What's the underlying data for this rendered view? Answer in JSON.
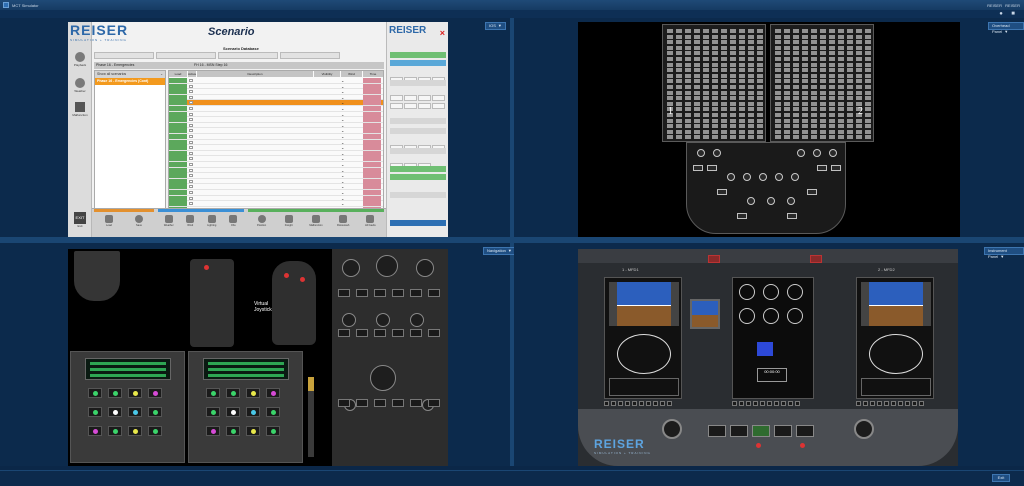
{
  "window": {
    "title": "MCT Simulator",
    "user": "REISER",
    "role": "REISER"
  },
  "quadrants": {
    "q1": {
      "view": "IOS"
    },
    "q2": {
      "view": "Overhead Panel"
    },
    "q3": {
      "view": "Navigation"
    },
    "q4": {
      "view": "Instrument Panel"
    }
  },
  "scenario": {
    "brand": "REISER",
    "tagline": "SIMULATION + TRAINING",
    "title": "Scenario",
    "database_title": "Scenario Database",
    "phase_label": "Phase 16 - Emergencies",
    "phase_right": "FH 16 - MSN Step 16",
    "list_header": "Show all scenarios",
    "selected_scenario": "Phase 16 - Emergencies (Cont)",
    "columns": [
      "Load",
      "Active",
      "Description",
      "Visibility",
      "Wind",
      "Time"
    ],
    "right_brand": "REISER",
    "right_close": "×",
    "exit_label": "EXIT",
    "exit_text": "Exit",
    "side_buttons": [
      "Playback",
      "Weather",
      "Malfunction"
    ],
    "bottom_groups": [
      {
        "label": "Scenario",
        "items": [
          "Load",
          "Save"
        ]
      },
      {
        "label": "Freeze",
        "items": [
          "Weather",
          "Wind",
          "Lighting",
          "Obs"
        ]
      },
      {
        "label": "Position",
        "items": [
          "Position",
          "Freight",
          "Malfunction",
          "Rotorwash",
          "All Faults"
        ]
      }
    ]
  },
  "overhead": {
    "bay_labels": [
      "1",
      "2"
    ]
  },
  "navigation": {
    "virtual_joystick_label": "Virtual\nJoystick"
  },
  "instrument_panel": {
    "brand": "REISER",
    "tagline": "SIMULATION + TRAINING",
    "tag_left": "1 - MFD1",
    "tag_right": "2 - MFD2",
    "clock": "00:00:00"
  },
  "footer": {
    "exit": "Exit"
  }
}
